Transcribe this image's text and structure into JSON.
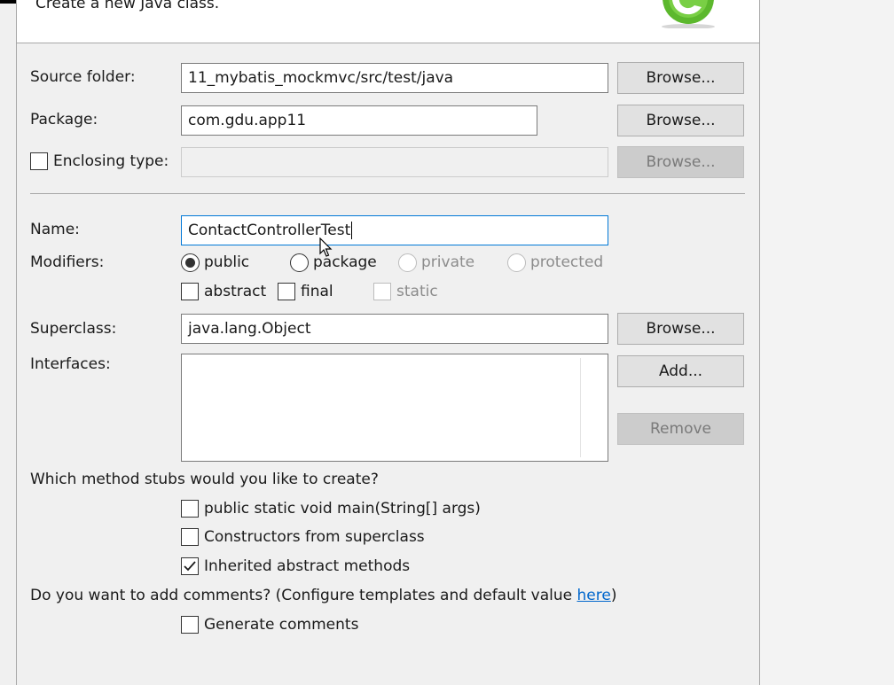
{
  "banner": {
    "text": "Create a new Java class."
  },
  "form": {
    "source_folder": {
      "label": "Source folder:",
      "value": "11_mybatis_mockmvc/src/test/java",
      "button": "Browse..."
    },
    "package": {
      "label": "Package:",
      "value": "com.gdu.app11",
      "button": "Browse..."
    },
    "enclosing": {
      "label": "Enclosing type:",
      "value": "",
      "button": "Browse...",
      "checked": false
    },
    "name": {
      "label": "Name:",
      "value": "ContactControllerTest"
    },
    "modifiers": {
      "label": "Modifiers:",
      "radios": [
        "public",
        "package",
        "private",
        "protected"
      ],
      "selected": "public",
      "checks": [
        "abstract",
        "final",
        "static"
      ]
    },
    "superclass": {
      "label": "Superclass:",
      "value": "java.lang.Object",
      "button": "Browse..."
    },
    "interfaces": {
      "label": "Interfaces:",
      "add_button": "Add...",
      "remove_button": "Remove"
    },
    "stubs": {
      "question": "Which method stubs would you like to create?",
      "items": [
        "public static void main(String[] args)",
        "Constructors from superclass",
        "Inherited abstract methods"
      ],
      "checked": [
        false,
        false,
        true
      ]
    },
    "comments": {
      "question_prefix": "Do you want to add comments? (Configure templates and default value ",
      "link": "here",
      "question_suffix": ")",
      "generate": "Generate comments"
    }
  },
  "colors": {
    "accent": "#0078d7",
    "link": "#0066cc",
    "logo": "#5cb82d"
  }
}
